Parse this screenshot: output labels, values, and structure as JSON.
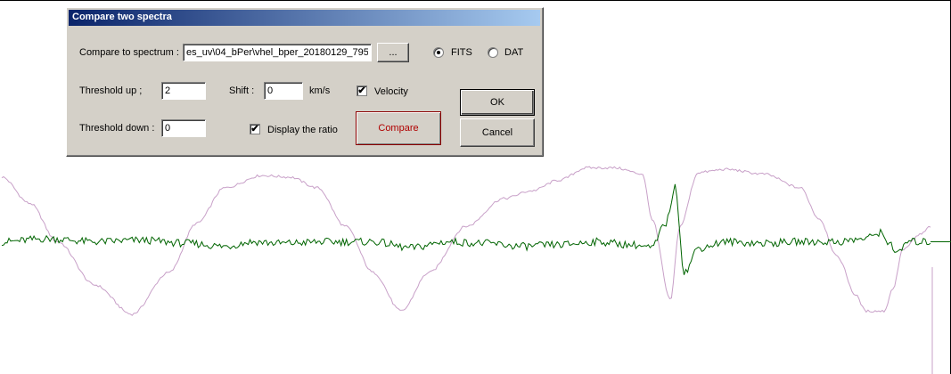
{
  "dialog": {
    "title": "Compare two spectra",
    "compare_label": "Compare to spectrum :",
    "spectrum_path": "es_uv\\04_bPer\\vhel_bper_20180129_795",
    "browse_label": "...",
    "format_options": [
      {
        "label": "FITS",
        "selected": true
      },
      {
        "label": "DAT",
        "selected": false
      }
    ],
    "threshold_up_label": "Threshold up ;",
    "threshold_up_value": "2",
    "threshold_down_label": "Threshold down :",
    "threshold_down_value": "0",
    "shift_label": "Shift :",
    "shift_value": "0",
    "shift_unit": "km/s",
    "velocity_label": "Velocity",
    "velocity_checked": true,
    "display_ratio_label": "Display the ratio",
    "display_ratio_checked": true,
    "compare_button": "Compare",
    "ok_button": "OK",
    "cancel_button": "Cancel",
    "check_glyph": "✔"
  },
  "colors": {
    "ratio_line": "#006400",
    "spectrum_line": "#c8a0c8",
    "title_bar": "#0a246a",
    "compare_text": "#b00000"
  },
  "chart_data": {
    "type": "line",
    "title": "",
    "xlabel": "",
    "ylabel": "",
    "series": [
      {
        "x": [
          0,
          0.03,
          0.06,
          0.1,
          0.14,
          0.18,
          0.21,
          0.24,
          0.28,
          0.31,
          0.34,
          0.37,
          0.4,
          0.43,
          0.46,
          0.5,
          0.54,
          0.57,
          0.6,
          0.63,
          0.66,
          0.69,
          0.7,
          0.72,
          0.73,
          0.75,
          0.78,
          0.82,
          0.86,
          0.88,
          0.9,
          0.92,
          0.93,
          0.95,
          0.96,
          0.97,
          0.99,
          1.0
        ],
        "y": [
          0.92,
          0.75,
          0.5,
          0.22,
          0.03,
          0.3,
          0.62,
          0.85,
          0.93,
          0.92,
          0.85,
          0.6,
          0.3,
          0.05,
          0.3,
          0.6,
          0.78,
          0.83,
          0.9,
          0.98,
          0.98,
          0.94,
          0.65,
          0.12,
          0.6,
          0.95,
          0.97,
          0.94,
          0.85,
          0.65,
          0.4,
          0.15,
          0.05,
          0.05,
          0.2,
          0.45,
          0.55,
          0.6
        ]
      },
      {
        "x": [
          0,
          0.05,
          0.1,
          0.15,
          0.2,
          0.24,
          0.27,
          0.3,
          0.35,
          0.4,
          0.44,
          0.48,
          0.52,
          0.56,
          0.6,
          0.64,
          0.68,
          0.7,
          0.715,
          0.725,
          0.735,
          0.75,
          0.78,
          0.82,
          0.86,
          0.9,
          0.93,
          0.945,
          0.955,
          0.965,
          0.975,
          1.0
        ],
        "y": [
          0.5,
          0.52,
          0.5,
          0.51,
          0.49,
          0.47,
          0.5,
          0.49,
          0.5,
          0.5,
          0.46,
          0.5,
          0.49,
          0.47,
          0.48,
          0.5,
          0.48,
          0.46,
          0.62,
          0.85,
          0.3,
          0.46,
          0.5,
          0.49,
          0.5,
          0.5,
          0.52,
          0.56,
          0.5,
          0.42,
          0.5,
          0.5
        ]
      }
    ]
  }
}
